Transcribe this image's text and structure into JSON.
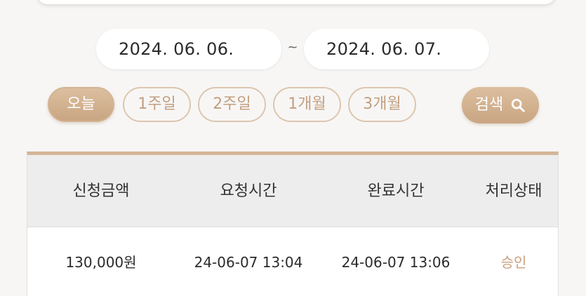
{
  "date_range": {
    "from": "2024. 06. 06.",
    "separator": "~",
    "to": "2024. 06. 07."
  },
  "period_filters": [
    {
      "label": "오늘",
      "active": true
    },
    {
      "label": "1주일",
      "active": false
    },
    {
      "label": "2주일",
      "active": false
    },
    {
      "label": "1개월",
      "active": false
    },
    {
      "label": "3개월",
      "active": false
    }
  ],
  "search_button": {
    "label": "검색",
    "icon": "search-icon"
  },
  "table": {
    "headers": [
      "신청금액",
      "요청시간",
      "완료시간",
      "처리상태"
    ],
    "rows": [
      {
        "amount": "130,000원",
        "requested_at": "24-06-07 13:04",
        "completed_at": "24-06-07 13:06",
        "status": "승인"
      }
    ]
  },
  "colors": {
    "accent": "#c9a582",
    "accent_light": "#dcc6ad",
    "status_approved": "#c9a07d",
    "table_header_bg": "#ededed",
    "page_bg": "#f7f6f5"
  }
}
